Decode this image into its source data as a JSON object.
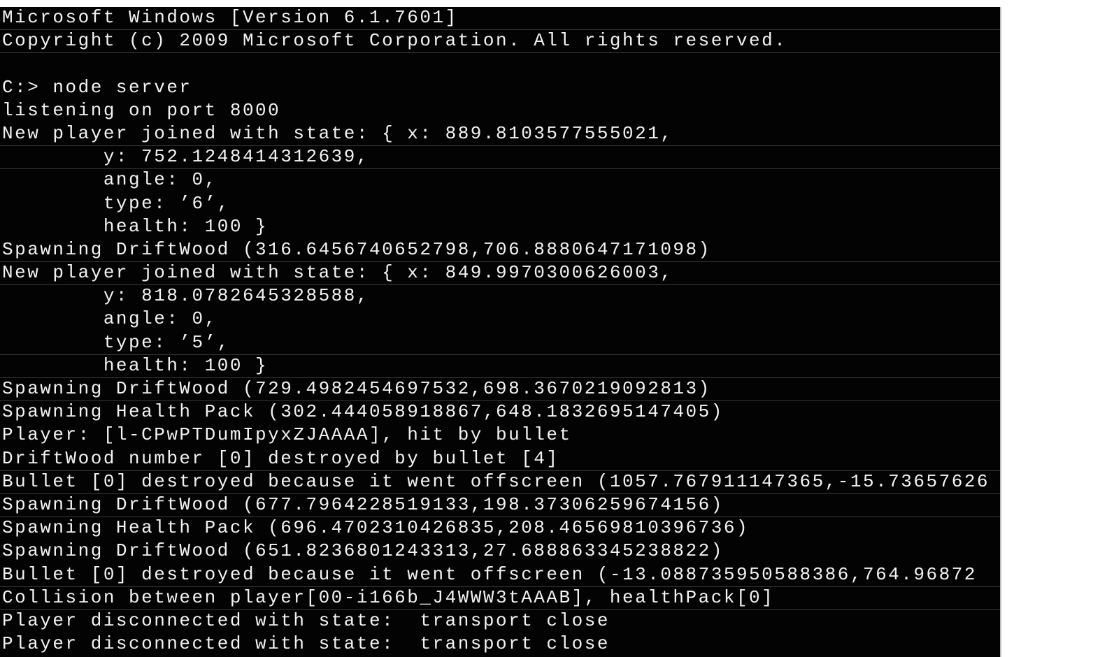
{
  "window": {
    "type": "command-prompt",
    "background_color": "#030303",
    "text_color": "#f2f2f2"
  },
  "console": {
    "lines": [
      {
        "text": "Microsoft Windows [Version 6.1.7601]",
        "sep": true
      },
      {
        "text": "Copyright (c) 2009 Microsoft Corporation. All rights reserved.",
        "sep": true
      },
      {
        "text": "",
        "sep": false
      },
      {
        "text": "C:> node server",
        "sep": false
      },
      {
        "text": "listening on port 8000",
        "sep": false
      },
      {
        "text": "New player joined with state: { x: 889.8103577555021,",
        "sep": true
      },
      {
        "text": "        y: 752.1248414312639,",
        "sep": true
      },
      {
        "text": "        angle: 0,",
        "sep": false
      },
      {
        "text": "        type: ’6’,",
        "sep": false
      },
      {
        "text": "        health: 100 }",
        "sep": false
      },
      {
        "text": "Spawning DriftWood (316.6456740652798,706.8880647171098)",
        "sep": true
      },
      {
        "text": "New player joined with state: { x: 849.9970300626003,",
        "sep": true
      },
      {
        "text": "        y: 818.0782645328588,",
        "sep": false
      },
      {
        "text": "        angle: 0,",
        "sep": false
      },
      {
        "text": "        type: ’5’,",
        "sep": true
      },
      {
        "text": "        health: 100 }",
        "sep": true
      },
      {
        "text": "Spawning DriftWood (729.4982454697532,698.3670219092813)",
        "sep": true
      },
      {
        "text": "Spawning Health Pack (302.444058918867,648.1832695147405)",
        "sep": false
      },
      {
        "text": "Player: [l-CPwPTDumIpyxZJAAAA], hit by bullet",
        "sep": false
      },
      {
        "text": "DriftWood number [0] destroyed by bullet [4]",
        "sep": true
      },
      {
        "text": "Bullet [0] destroyed because it went offscreen (1057.767911147365,-15.73657626",
        "sep": true
      },
      {
        "text": "Spawning DriftWood (677.7964228519133,198.37306259674156)",
        "sep": true
      },
      {
        "text": "Spawning Health Pack (696.4702310426835,208.46569810396736)",
        "sep": false
      },
      {
        "text": "Spawning DriftWood (651.8236801243313,27.688863345238822)",
        "sep": false
      },
      {
        "text": "Bullet [0] destroyed because it went offscreen (-13.088735950588386,764.96872",
        "sep": true
      },
      {
        "text": "Collision between player[00-i166b_J4WWW3tAAAB], healthPack[0]",
        "sep": true
      },
      {
        "text": "Player disconnected with state:  transport close",
        "sep": false
      },
      {
        "text": "Player disconnected with state:  transport close",
        "sep": false
      }
    ]
  }
}
